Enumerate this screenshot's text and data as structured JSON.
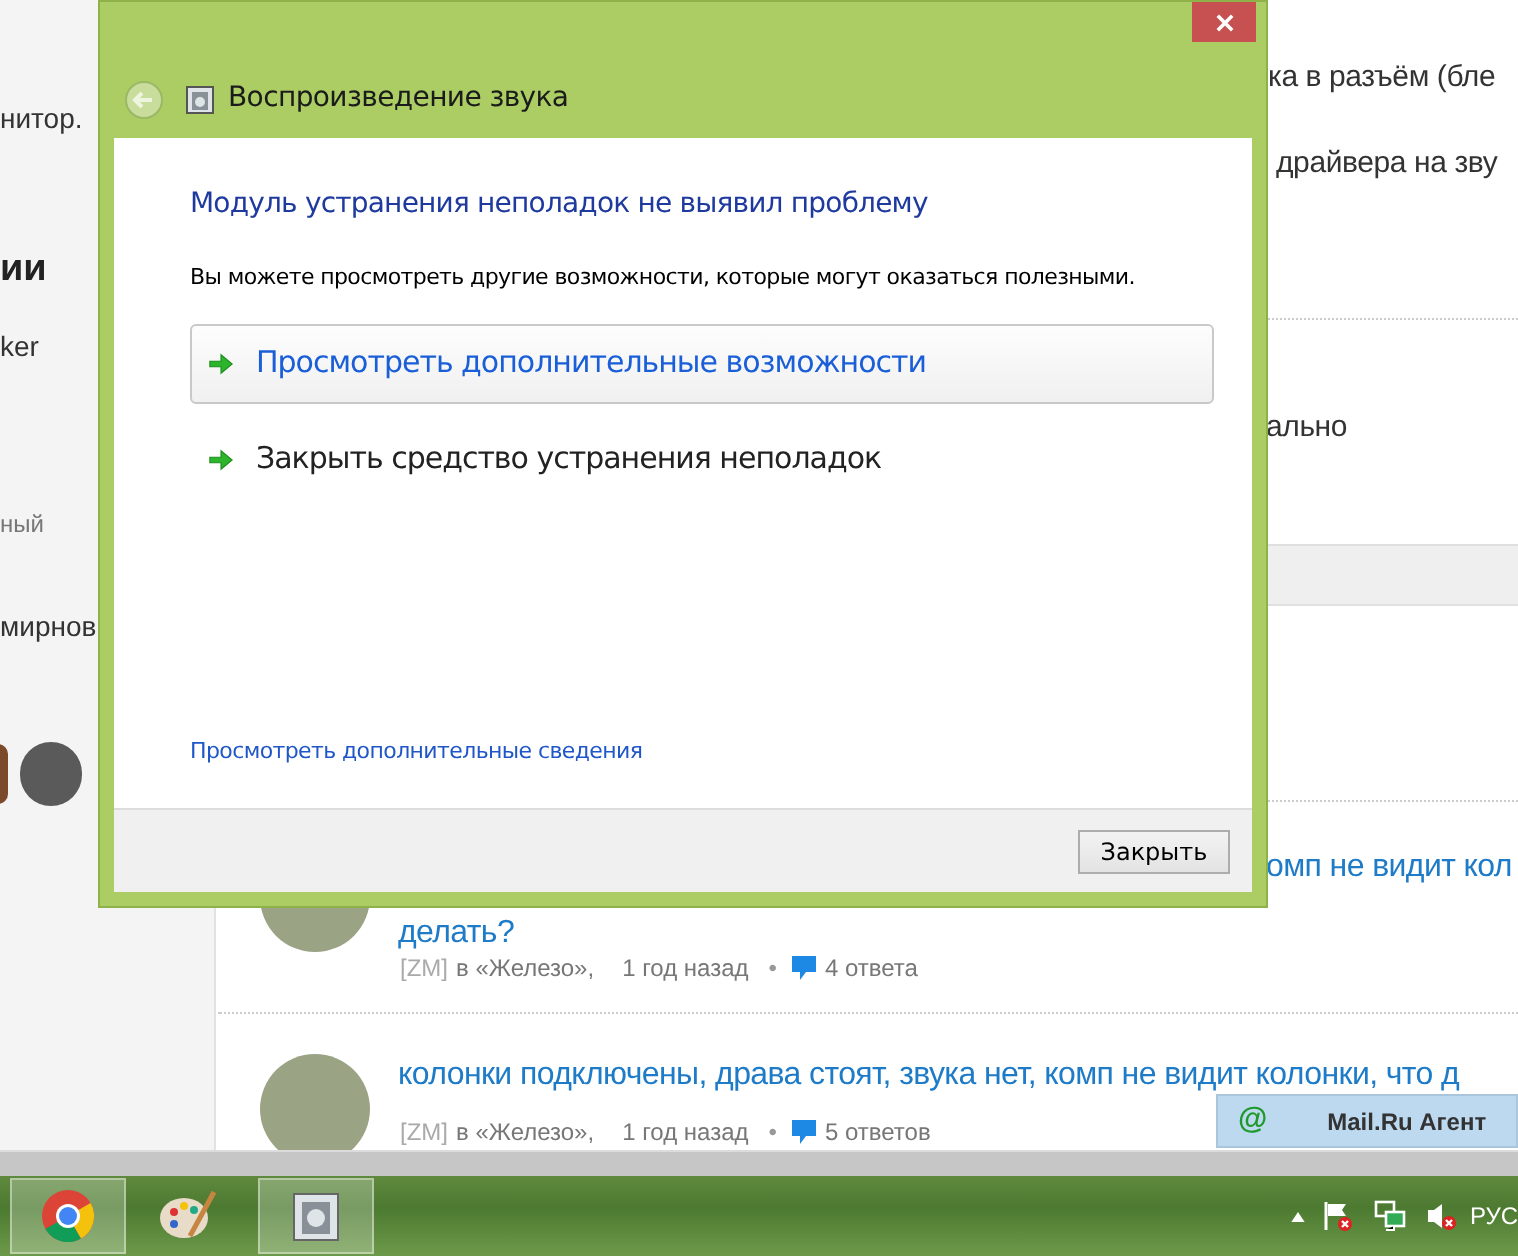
{
  "background_page": {
    "left_column": [
      {
        "kind": "text",
        "text": "нитор."
      },
      {
        "kind": "heading",
        "text": "ии"
      },
      {
        "kind": "text",
        "text": "ker"
      },
      {
        "kind": "muted",
        "text": "ный"
      },
      {
        "kind": "text",
        "text": "мирнов"
      }
    ],
    "main_fragments": [
      "ка в разъём (бле",
      "драйвера на зву",
      "ально"
    ],
    "topics": [
      {
        "title_parts": [
          "омп не видит кол",
          "делать?"
        ],
        "author": "[ZM]",
        "forum": "в «Железо»,",
        "time": "1 год назад",
        "separator": "•",
        "replies": "4 ответа"
      },
      {
        "title_parts": [
          "колонки подключены, драва стоят, звука нет, комп не видит колонки, что д"
        ],
        "author": "[ZM]",
        "forum": "в «Железо»,",
        "time": "1 год назад",
        "separator": "•",
        "replies": "5 ответов"
      }
    ]
  },
  "dialog": {
    "title": "Воспроизведение звука",
    "heading": "Модуль устранения неполадок не выявил проблему",
    "description": "Вы можете просмотреть другие возможности, которые могут оказаться полезными.",
    "options": [
      {
        "label": "Просмотреть дополнительные возможности",
        "selected": true
      },
      {
        "label": "Закрыть средство устранения неполадок",
        "selected": false
      }
    ],
    "details_link": "Просмотреть дополнительные сведения",
    "buttons": [
      "Закрыть"
    ]
  },
  "notification": {
    "icon": "@",
    "title": "Mail.Ru Агент"
  },
  "taskbar": {
    "apps": [
      {
        "kind": "browser",
        "active": true
      },
      {
        "kind": "paint",
        "active": false
      },
      {
        "kind": "audio",
        "active": true
      }
    ],
    "language": "РУС"
  }
}
